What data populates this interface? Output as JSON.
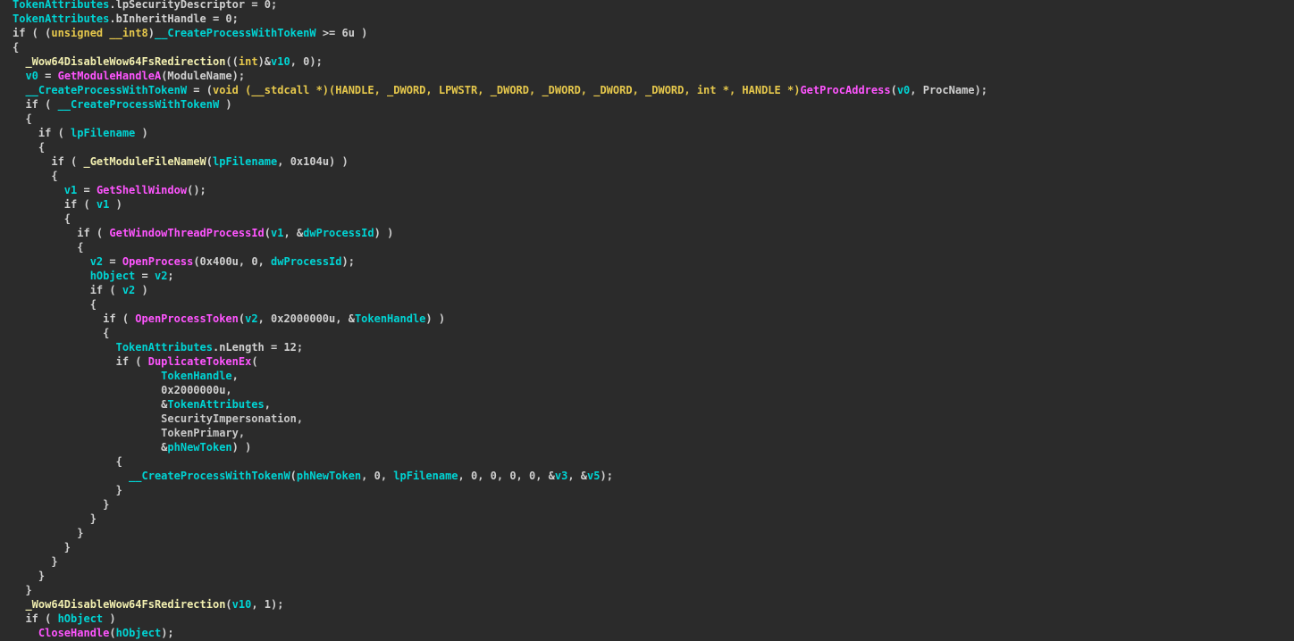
{
  "editor": {
    "lines": [
      [
        {
          "t": "TokenAttributes",
          "c": "var"
        },
        {
          "t": ".lpSecurityDescriptor = 0;",
          "c": "plain"
        }
      ],
      [
        {
          "t": "TokenAttributes",
          "c": "var"
        },
        {
          "t": ".bInheritHandle = 0;",
          "c": "plain"
        }
      ],
      [
        {
          "t": "if ( (",
          "c": "plain"
        },
        {
          "t": "unsigned __int8",
          "c": "kw"
        },
        {
          "t": ")",
          "c": "plain"
        },
        {
          "t": "__CreateProcessWithTokenW",
          "c": "var"
        },
        {
          "t": " >= 6u )",
          "c": "plain"
        }
      ],
      [
        {
          "t": "{",
          "c": "plain"
        }
      ],
      [
        {
          "t": "  ",
          "c": "plain"
        },
        {
          "t": "_Wow64DisableWow64FsRedirection",
          "c": "imp"
        },
        {
          "t": "((",
          "c": "plain"
        },
        {
          "t": "int",
          "c": "kw"
        },
        {
          "t": ")&",
          "c": "plain"
        },
        {
          "t": "v10",
          "c": "var"
        },
        {
          "t": ", 0);",
          "c": "plain"
        }
      ],
      [
        {
          "t": "  ",
          "c": "plain"
        },
        {
          "t": "v0",
          "c": "var"
        },
        {
          "t": " = ",
          "c": "plain"
        },
        {
          "t": "GetModuleHandleA",
          "c": "func"
        },
        {
          "t": "(ModuleName);",
          "c": "plain"
        }
      ],
      [
        {
          "t": "  ",
          "c": "plain"
        },
        {
          "t": "__CreateProcessWithTokenW",
          "c": "var"
        },
        {
          "t": " = (",
          "c": "plain"
        },
        {
          "t": "void (__stdcall *)(HANDLE, _DWORD, LPWSTR, _DWORD, _DWORD, _DWORD, _DWORD, int *, HANDLE *)",
          "c": "kw"
        },
        {
          "t": "GetProcAddress",
          "c": "func"
        },
        {
          "t": "(",
          "c": "plain"
        },
        {
          "t": "v0",
          "c": "var"
        },
        {
          "t": ", ProcName);",
          "c": "plain"
        }
      ],
      [
        {
          "t": "  if ( ",
          "c": "plain"
        },
        {
          "t": "__CreateProcessWithTokenW",
          "c": "var"
        },
        {
          "t": " )",
          "c": "plain"
        }
      ],
      [
        {
          "t": "  {",
          "c": "plain"
        }
      ],
      [
        {
          "t": "    if ( ",
          "c": "plain"
        },
        {
          "t": "lpFilename",
          "c": "var"
        },
        {
          "t": " )",
          "c": "plain"
        }
      ],
      [
        {
          "t": "    {",
          "c": "plain"
        }
      ],
      [
        {
          "t": "      if ( ",
          "c": "plain"
        },
        {
          "t": "_GetModuleFileNameW",
          "c": "imp"
        },
        {
          "t": "(",
          "c": "plain"
        },
        {
          "t": "lpFilename",
          "c": "var"
        },
        {
          "t": ", 0x104u) )",
          "c": "plain"
        }
      ],
      [
        {
          "t": "      {",
          "c": "plain"
        }
      ],
      [
        {
          "t": "        ",
          "c": "plain"
        },
        {
          "t": "v1",
          "c": "var"
        },
        {
          "t": " = ",
          "c": "plain"
        },
        {
          "t": "GetShellWindow",
          "c": "func"
        },
        {
          "t": "();",
          "c": "plain"
        }
      ],
      [
        {
          "t": "        if ( ",
          "c": "plain"
        },
        {
          "t": "v1",
          "c": "var"
        },
        {
          "t": " )",
          "c": "plain"
        }
      ],
      [
        {
          "t": "        {",
          "c": "plain"
        }
      ],
      [
        {
          "t": "          if ( ",
          "c": "plain"
        },
        {
          "t": "GetWindowThreadProcessId",
          "c": "func"
        },
        {
          "t": "(",
          "c": "plain"
        },
        {
          "t": "v1",
          "c": "var"
        },
        {
          "t": ", &",
          "c": "plain"
        },
        {
          "t": "dwProcessId",
          "c": "var"
        },
        {
          "t": ") )",
          "c": "plain"
        }
      ],
      [
        {
          "t": "          {",
          "c": "plain"
        }
      ],
      [
        {
          "t": "            ",
          "c": "plain"
        },
        {
          "t": "v2",
          "c": "var"
        },
        {
          "t": " = ",
          "c": "plain"
        },
        {
          "t": "OpenProcess",
          "c": "func"
        },
        {
          "t": "(0x400u, 0, ",
          "c": "plain"
        },
        {
          "t": "dwProcessId",
          "c": "var"
        },
        {
          "t": ");",
          "c": "plain"
        }
      ],
      [
        {
          "t": "            ",
          "c": "plain"
        },
        {
          "t": "hObject",
          "c": "var"
        },
        {
          "t": " = ",
          "c": "plain"
        },
        {
          "t": "v2",
          "c": "var"
        },
        {
          "t": ";",
          "c": "plain"
        }
      ],
      [
        {
          "t": "            if ( ",
          "c": "plain"
        },
        {
          "t": "v2",
          "c": "var"
        },
        {
          "t": " )",
          "c": "plain"
        }
      ],
      [
        {
          "t": "            {",
          "c": "plain"
        }
      ],
      [
        {
          "t": "              if ( ",
          "c": "plain"
        },
        {
          "t": "OpenProcessToken",
          "c": "func"
        },
        {
          "t": "(",
          "c": "plain"
        },
        {
          "t": "v2",
          "c": "var"
        },
        {
          "t": ", 0x2000000u, &",
          "c": "plain"
        },
        {
          "t": "TokenHandle",
          "c": "var"
        },
        {
          "t": ") )",
          "c": "plain"
        }
      ],
      [
        {
          "t": "              {",
          "c": "plain"
        }
      ],
      [
        {
          "t": "                ",
          "c": "plain"
        },
        {
          "t": "TokenAttributes",
          "c": "var"
        },
        {
          "t": ".nLength = 12;",
          "c": "plain"
        }
      ],
      [
        {
          "t": "                if ( ",
          "c": "plain"
        },
        {
          "t": "DuplicateTokenEx",
          "c": "func"
        },
        {
          "t": "(",
          "c": "plain"
        }
      ],
      [
        {
          "t": "                       ",
          "c": "plain"
        },
        {
          "t": "TokenHandle",
          "c": "var"
        },
        {
          "t": ",",
          "c": "plain"
        }
      ],
      [
        {
          "t": "                       0x2000000u,",
          "c": "plain"
        }
      ],
      [
        {
          "t": "                       &",
          "c": "plain"
        },
        {
          "t": "TokenAttributes",
          "c": "var"
        },
        {
          "t": ",",
          "c": "plain"
        }
      ],
      [
        {
          "t": "                       SecurityImpersonation,",
          "c": "dim"
        }
      ],
      [
        {
          "t": "                       TokenPrimary,",
          "c": "dim"
        }
      ],
      [
        {
          "t": "                       &",
          "c": "plain"
        },
        {
          "t": "phNewToken",
          "c": "var"
        },
        {
          "t": ") )",
          "c": "plain"
        }
      ],
      [
        {
          "t": "                {",
          "c": "plain"
        }
      ],
      [
        {
          "t": "                  ",
          "c": "plain"
        },
        {
          "t": "__CreateProcessWithTokenW",
          "c": "var"
        },
        {
          "t": "(",
          "c": "plain"
        },
        {
          "t": "phNewToken",
          "c": "var"
        },
        {
          "t": ", 0, ",
          "c": "plain"
        },
        {
          "t": "lpFilename",
          "c": "var"
        },
        {
          "t": ", 0, 0, 0, 0, &",
          "c": "plain"
        },
        {
          "t": "v3",
          "c": "var"
        },
        {
          "t": ", &",
          "c": "plain"
        },
        {
          "t": "v5",
          "c": "var"
        },
        {
          "t": ");",
          "c": "plain"
        }
      ],
      [
        {
          "t": "                }",
          "c": "plain"
        }
      ],
      [
        {
          "t": "              }",
          "c": "plain"
        }
      ],
      [
        {
          "t": "            }",
          "c": "plain"
        }
      ],
      [
        {
          "t": "          }",
          "c": "plain"
        }
      ],
      [
        {
          "t": "        }",
          "c": "plain"
        }
      ],
      [
        {
          "t": "      }",
          "c": "plain"
        }
      ],
      [
        {
          "t": "    }",
          "c": "plain"
        }
      ],
      [
        {
          "t": "  }",
          "c": "plain"
        }
      ],
      [
        {
          "t": "  ",
          "c": "plain"
        },
        {
          "t": "_Wow64DisableWow64FsRedirection",
          "c": "imp"
        },
        {
          "t": "(",
          "c": "plain"
        },
        {
          "t": "v10",
          "c": "var"
        },
        {
          "t": ", 1);",
          "c": "plain"
        }
      ],
      [
        {
          "t": "  if ( ",
          "c": "plain"
        },
        {
          "t": "hObject",
          "c": "var"
        },
        {
          "t": " )",
          "c": "plain"
        }
      ],
      [
        {
          "t": "    ",
          "c": "plain"
        },
        {
          "t": "CloseHandle",
          "c": "func"
        },
        {
          "t": "(",
          "c": "plain"
        },
        {
          "t": "hObject",
          "c": "var"
        },
        {
          "t": ");",
          "c": "plain"
        }
      ]
    ]
  }
}
